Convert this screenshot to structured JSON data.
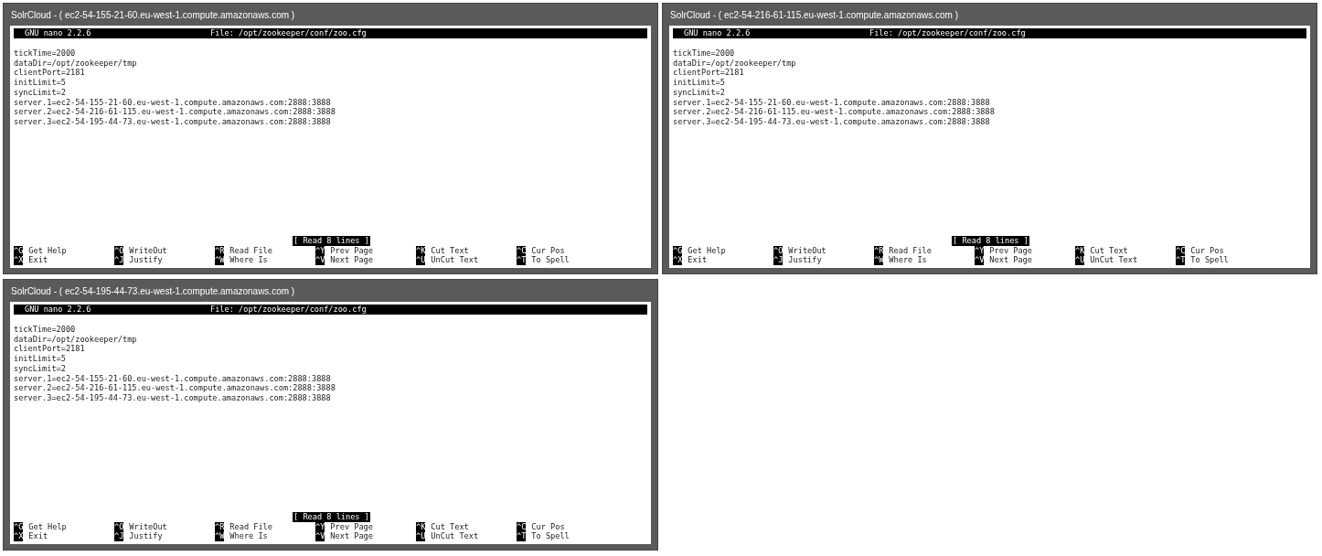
{
  "windows": [
    {
      "title": "SolrCloud - ( ec2-54-155-21-60.eu-west-1.compute.amazonaws.com )",
      "terminal": {
        "app": "GNU nano 2.2.6",
        "file": "File: /opt/zookeeper/conf/zoo.cfg",
        "lines": [
          "tickTime=2000",
          "dataDir=/opt/zookeeper/tmp",
          "clientPort=2181",
          "initLimit=5",
          "syncLimit=2",
          "server.1=ec2-54-155-21-60.eu-west-1.compute.amazonaws.com:2888:3888",
          "server.2=ec2-54-216-61-115.eu-west-1.compute.amazonaws.com:2888:3888",
          "server.3=ec2-54-195-44-73.eu-west-1.compute.amazonaws.com:2888:3888"
        ],
        "status": "[ Read 8 lines ]",
        "shortcuts": [
          {
            "key": "^G",
            "label": "Get Help"
          },
          {
            "key": "^O",
            "label": "WriteOut"
          },
          {
            "key": "^R",
            "label": "Read File"
          },
          {
            "key": "^Y",
            "label": "Prev Page"
          },
          {
            "key": "^K",
            "label": "Cut Text"
          },
          {
            "key": "^C",
            "label": "Cur Pos"
          },
          {
            "key": "^X",
            "label": "Exit"
          },
          {
            "key": "^J",
            "label": "Justify"
          },
          {
            "key": "^W",
            "label": "Where Is"
          },
          {
            "key": "^V",
            "label": "Next Page"
          },
          {
            "key": "^U",
            "label": "UnCut Text"
          },
          {
            "key": "^T",
            "label": "To Spell"
          }
        ]
      }
    },
    {
      "title": "SolrCloud - ( ec2-54-216-61-115.eu-west-1.compute.amazonaws.com )",
      "terminal": {
        "app": "GNU nano 2.2.6",
        "file": "File: /opt/zookeeper/conf/zoo.cfg",
        "lines": [
          "tickTime=2000",
          "dataDir=/opt/zookeeper/tmp",
          "clientPort=2181",
          "initLimit=5",
          "syncLimit=2",
          "server.1=ec2-54-155-21-60.eu-west-1.compute.amazonaws.com:2888:3888",
          "server.2=ec2-54-216-61-115.eu-west-1.compute.amazonaws.com:2888:3888",
          "server.3=ec2-54-195-44-73.eu-west-1.compute.amazonaws.com:2888:3888"
        ],
        "status": "[ Read 8 lines ]",
        "shortcuts": [
          {
            "key": "^G",
            "label": "Get Help"
          },
          {
            "key": "^O",
            "label": "WriteOut"
          },
          {
            "key": "^R",
            "label": "Read File"
          },
          {
            "key": "^Y",
            "label": "Prev Page"
          },
          {
            "key": "^K",
            "label": "Cut Text"
          },
          {
            "key": "^C",
            "label": "Cur Pos"
          },
          {
            "key": "^X",
            "label": "Exit"
          },
          {
            "key": "^J",
            "label": "Justify"
          },
          {
            "key": "^W",
            "label": "Where Is"
          },
          {
            "key": "^V",
            "label": "Next Page"
          },
          {
            "key": "^U",
            "label": "UnCut Text"
          },
          {
            "key": "^T",
            "label": "To Spell"
          }
        ]
      }
    },
    {
      "title": "SolrCloud - ( ec2-54-195-44-73.eu-west-1.compute.amazonaws.com )",
      "terminal": {
        "app": "GNU nano 2.2.6",
        "file": "File: /opt/zookeeper/conf/zoo.cfg",
        "lines": [
          "tickTime=2000",
          "dataDir=/opt/zookeeper/tmp",
          "clientPort=2181",
          "initLimit=5",
          "syncLimit=2",
          "server.1=ec2-54-155-21-60.eu-west-1.compute.amazonaws.com:2888:3888",
          "server.2=ec2-54-216-61-115.eu-west-1.compute.amazonaws.com:2888:3888",
          "server.3=ec2-54-195-44-73.eu-west-1.compute.amazonaws.com:2888:3888"
        ],
        "status": "[ Read 8 lines ]",
        "shortcuts": [
          {
            "key": "^G",
            "label": "Get Help"
          },
          {
            "key": "^O",
            "label": "WriteOut"
          },
          {
            "key": "^R",
            "label": "Read File"
          },
          {
            "key": "^Y",
            "label": "Prev Page"
          },
          {
            "key": "^K",
            "label": "Cut Text"
          },
          {
            "key": "^C",
            "label": "Cur Pos"
          },
          {
            "key": "^X",
            "label": "Exit"
          },
          {
            "key": "^J",
            "label": "Justify"
          },
          {
            "key": "^W",
            "label": "Where Is"
          },
          {
            "key": "^V",
            "label": "Next Page"
          },
          {
            "key": "^U",
            "label": "UnCut Text"
          },
          {
            "key": "^T",
            "label": "To Spell"
          }
        ]
      }
    }
  ]
}
